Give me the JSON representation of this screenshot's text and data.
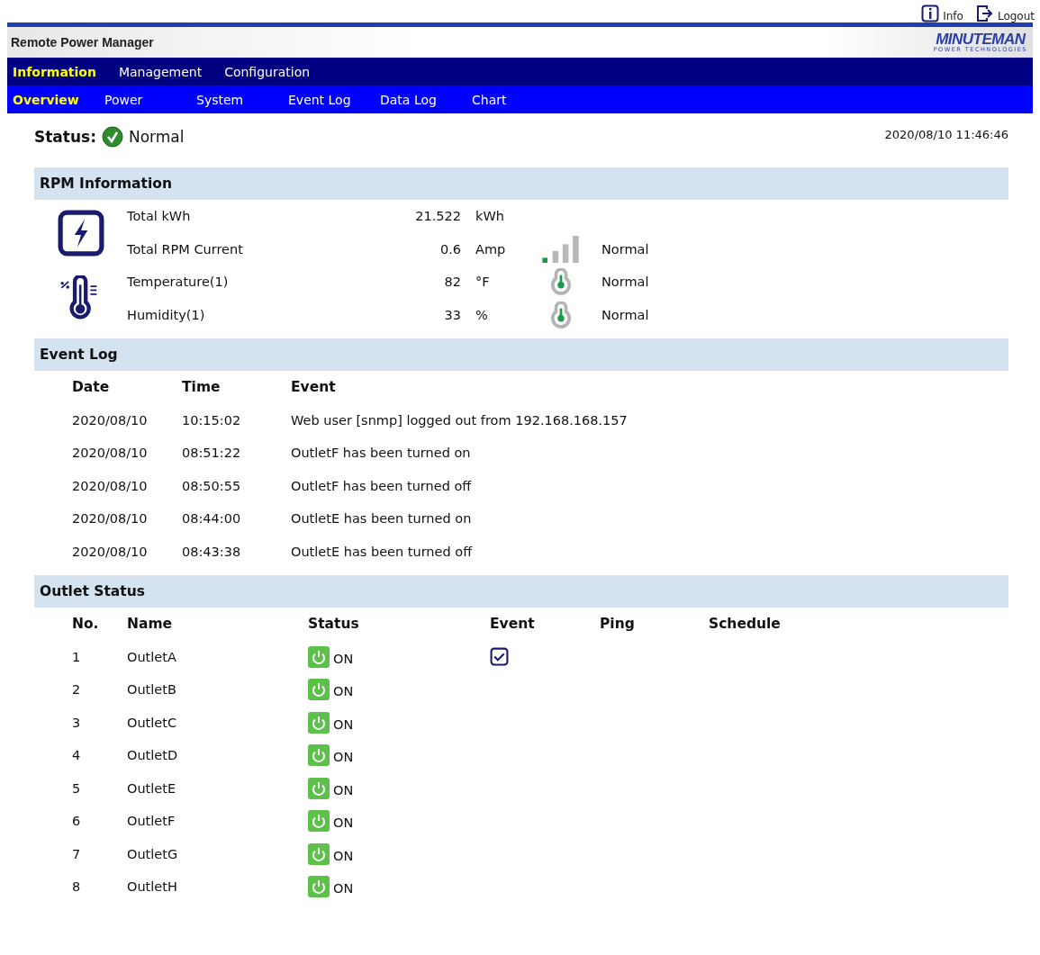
{
  "top_links": [
    {
      "kind": "info",
      "label": "Info"
    },
    {
      "kind": "logout",
      "label": "Logout"
    }
  ],
  "app_title": "Remote Power Manager",
  "logo": {
    "name": "MINUTEMAN",
    "tagline": "POWER TECHNOLOGIES"
  },
  "main_tabs": [
    {
      "label": "Information",
      "selected": true
    },
    {
      "label": "Management",
      "selected": false
    },
    {
      "label": "Configuration",
      "selected": false
    }
  ],
  "sub_tabs": [
    {
      "label": "Overview",
      "selected": true
    },
    {
      "label": "Power",
      "selected": false
    },
    {
      "label": "System",
      "selected": false
    },
    {
      "label": "Event Log",
      "selected": false
    },
    {
      "label": "Data Log",
      "selected": false
    },
    {
      "label": "Chart",
      "selected": false
    }
  ],
  "status": {
    "label": "Status:",
    "value": "Normal",
    "datetime": "2020/08/10 11:46:46"
  },
  "rpm": {
    "title": "RPM Information",
    "groups": [
      {
        "kind": "power",
        "rows": [
          {
            "label": "Total kWh",
            "value": "21.522",
            "unit": "kWh"
          },
          {
            "label": "Total RPM Current",
            "value": "0.6",
            "unit": "Amp",
            "kind": "load",
            "state": "Normal"
          }
        ]
      },
      {
        "kind": "environment",
        "rows": [
          {
            "label": "Temperature(1)",
            "value": "82",
            "unit": "°F",
            "kind": "sensor",
            "state": "Normal"
          },
          {
            "label": "Humidity(1)",
            "value": "33",
            "unit": "%",
            "kind": "sensor",
            "state": "Normal"
          }
        ]
      }
    ]
  },
  "event_log": {
    "title": "Event Log",
    "columns": [
      "Date",
      "Time",
      "Event"
    ],
    "rows": [
      [
        "2020/08/10",
        "10:15:02",
        "Web user [snmp] logged out from 192.168.168.157"
      ],
      [
        "2020/08/10",
        "08:51:22",
        "OutletF has been turned on"
      ],
      [
        "2020/08/10",
        "08:50:55",
        "OutletF has been turned off"
      ],
      [
        "2020/08/10",
        "08:44:00",
        "OutletE has been turned on"
      ],
      [
        "2020/08/10",
        "08:43:38",
        "OutletE has been turned off"
      ]
    ]
  },
  "outlets": {
    "title": "Outlet Status",
    "columns": [
      "No.",
      "Name",
      "Status",
      "Event",
      "Ping",
      "Schedule"
    ],
    "rows": [
      {
        "no": "1",
        "name": "OutletA",
        "status": "ON",
        "event": true
      },
      {
        "no": "2",
        "name": "OutletB",
        "status": "ON",
        "event": false
      },
      {
        "no": "3",
        "name": "OutletC",
        "status": "ON",
        "event": false
      },
      {
        "no": "4",
        "name": "OutletD",
        "status": "ON",
        "event": false
      },
      {
        "no": "5",
        "name": "OutletE",
        "status": "ON",
        "event": false
      },
      {
        "no": "6",
        "name": "OutletF",
        "status": "ON",
        "event": false
      },
      {
        "no": "7",
        "name": "OutletG",
        "status": "ON",
        "event": false
      },
      {
        "no": "8",
        "name": "OutletH",
        "status": "ON",
        "event": false
      }
    ]
  }
}
